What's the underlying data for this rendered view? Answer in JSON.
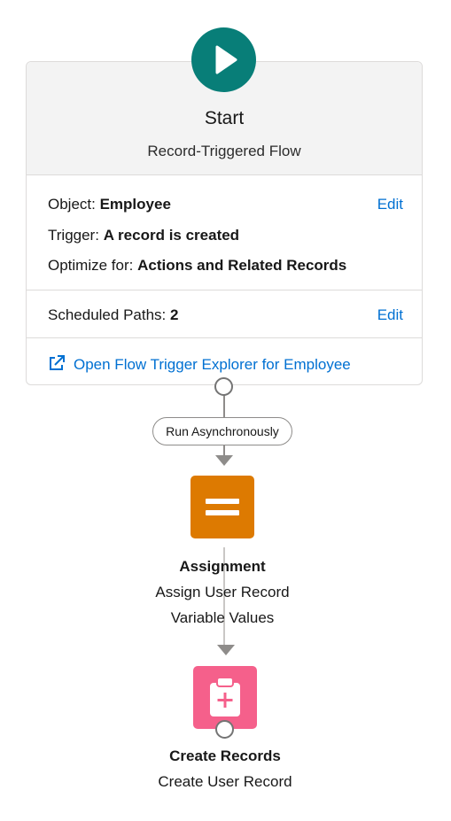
{
  "start": {
    "title": "Start",
    "subtitle": "Record-Triggered Flow",
    "icon": "play-icon",
    "color": "#087e78"
  },
  "details": {
    "object_label": "Object:",
    "object_value": "Employee",
    "trigger_label": "Trigger:",
    "trigger_value": "A record is created",
    "optimize_label": "Optimize for:",
    "optimize_value": "Actions and Related Records",
    "edit_label": "Edit"
  },
  "scheduled": {
    "label": "Scheduled Paths:",
    "value": "2",
    "edit_label": "Edit"
  },
  "explorer_link": {
    "label": "Open Flow Trigger Explorer for Employee",
    "icon": "external-link-icon"
  },
  "path_pill": "Run Asynchronously",
  "assignment": {
    "title": "Assignment",
    "description_line1": "Assign User Record",
    "description_line2": "Variable Values",
    "icon": "equals-icon",
    "color": "#dd7a01"
  },
  "create": {
    "title": "Create Records",
    "description": "Create User Record",
    "icon": "clipboard-plus-icon",
    "color": "#f5608b"
  },
  "colors": {
    "link": "#0070d2",
    "connector": "#8e8c8a"
  }
}
